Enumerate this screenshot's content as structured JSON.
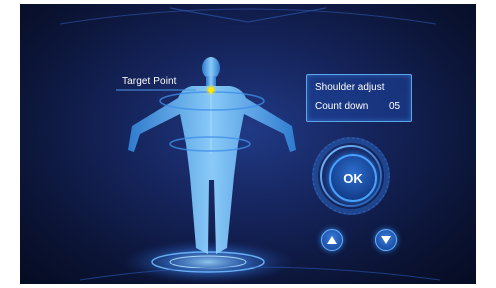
{
  "target_label": "Target Point",
  "info_panel": {
    "title": "Shoulder  adjust",
    "countdown_label": "Count down",
    "countdown_value": "05"
  },
  "controls": {
    "ok_label": "OK",
    "up_icon": "triangle-up",
    "down_icon": "triangle-down"
  },
  "colors": {
    "accent": "#48a0ff",
    "body": "#5fb4f2",
    "target_dot": "#ffe600"
  }
}
